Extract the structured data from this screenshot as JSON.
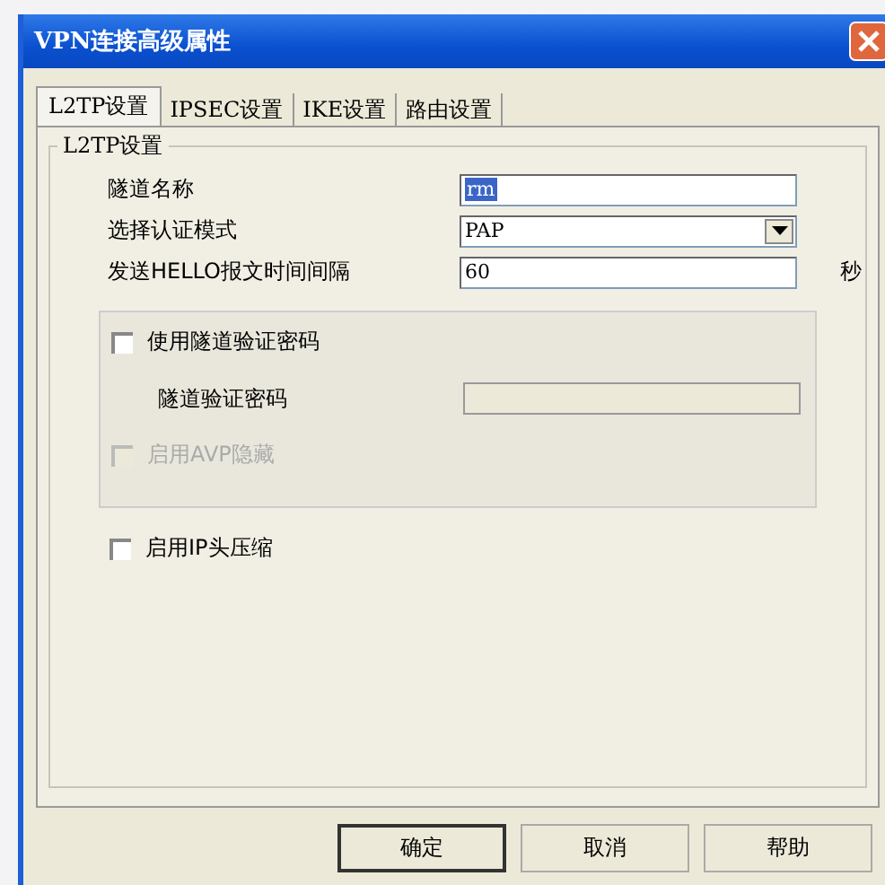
{
  "window": {
    "title": "VPN连接高级属性"
  },
  "tabs": [
    {
      "label": "L2TP设置",
      "selected": true
    },
    {
      "label": "IPSEC设置",
      "selected": false
    },
    {
      "label": "IKE设置",
      "selected": false
    },
    {
      "label": "路由设置",
      "selected": false
    }
  ],
  "group": {
    "title": "L2TP设置",
    "fields": [
      {
        "kind": "text",
        "label": "隧道名称",
        "value": "rm",
        "value_selected": true
      },
      {
        "kind": "select",
        "label": "选择认证模式",
        "value": "PAP"
      },
      {
        "kind": "text",
        "label": "发送HELLO报文时间间隔",
        "value": "60",
        "unit": "秒",
        "value_selected": false
      }
    ],
    "tunnel_auth": {
      "checkbox": {
        "label": "使用隧道验证密码",
        "checked": false,
        "disabled": false
      },
      "password_label": "隧道验证密码",
      "password_disabled": true,
      "avp_checkbox": {
        "label": "启用AVP隐藏",
        "checked": false,
        "disabled": true
      }
    },
    "compress_checkbox": {
      "label": "启用IP头压缩",
      "checked": false,
      "disabled": false
    }
  },
  "buttons": [
    {
      "label": "确定",
      "default": true
    },
    {
      "label": "取消",
      "default": false
    },
    {
      "label": "帮助",
      "default": false
    }
  ]
}
